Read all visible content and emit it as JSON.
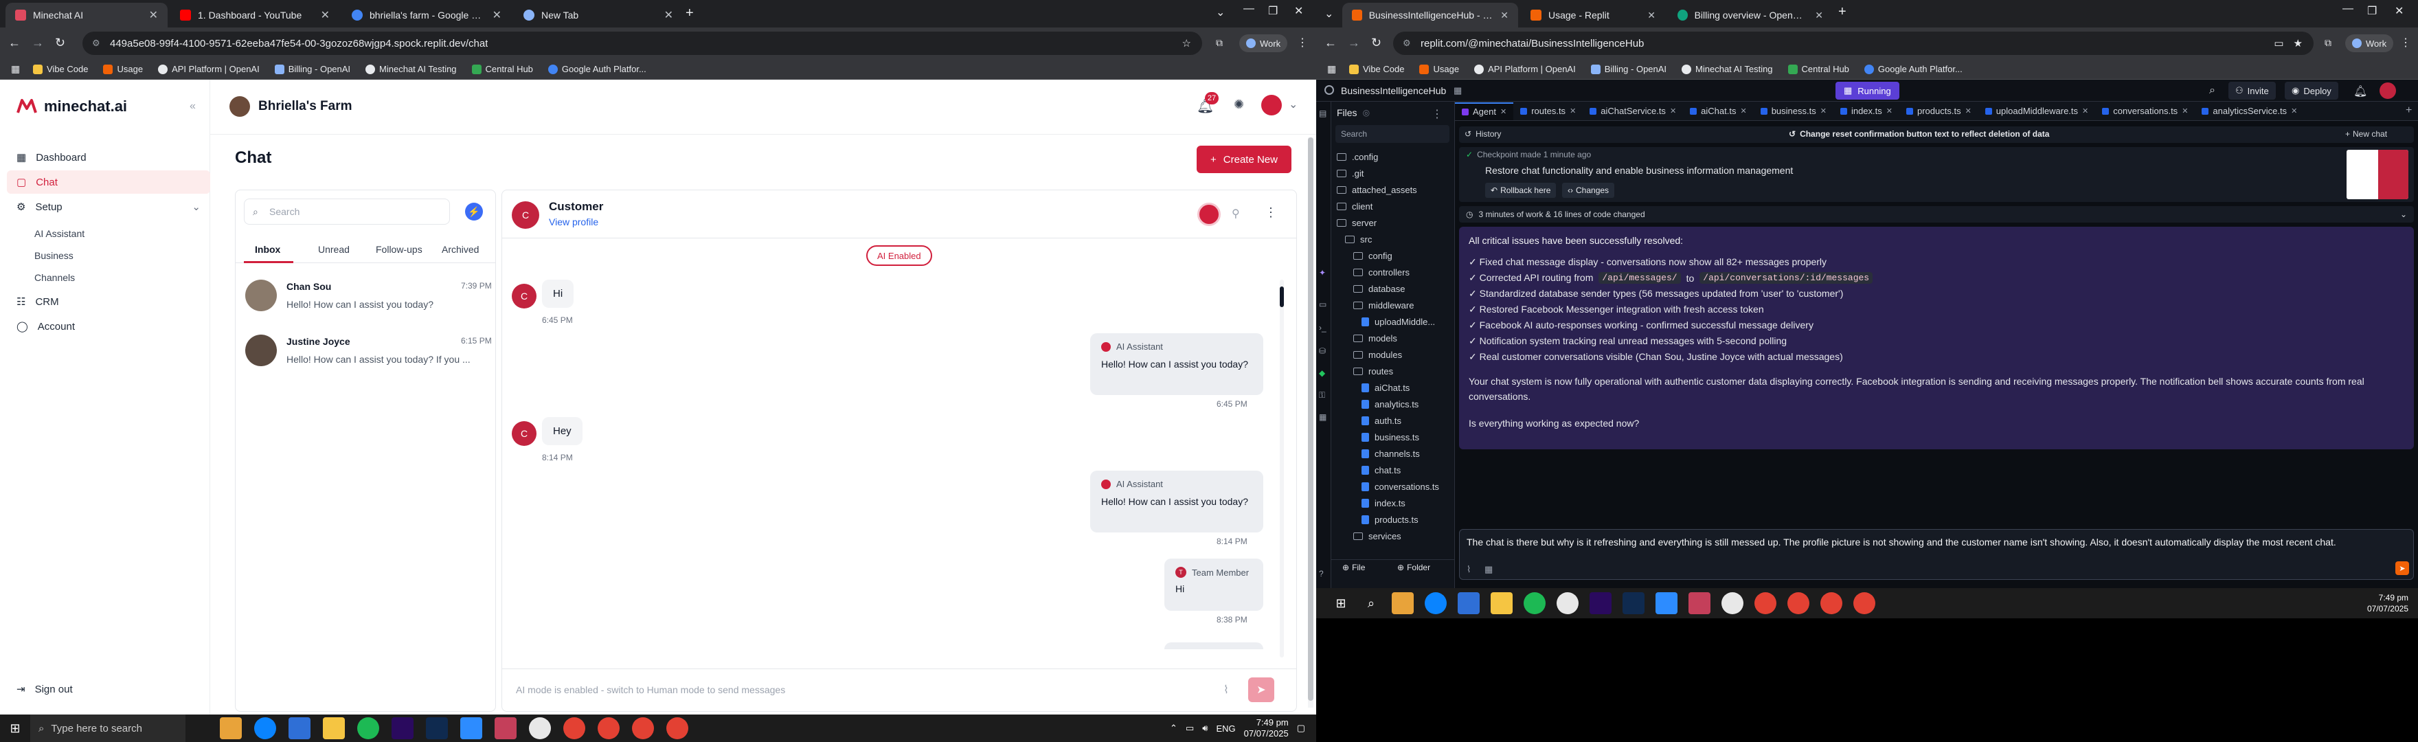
{
  "left_browser": {
    "tabs": [
      {
        "title": "Minechat AI",
        "color": "#e04a5f"
      },
      {
        "title": "1. Dashboard - YouTube",
        "color": "#ff0000"
      },
      {
        "title": "bhriella's farm - Google Search",
        "color": "#4285f4"
      },
      {
        "title": "New Tab",
        "color": "#8ab4f8"
      }
    ],
    "url": "449a5e08-99f4-4100-9571-62eeba47fe54-00-3gozoz68wjgp4.spock.replit.dev/chat",
    "profile": "Work",
    "bookmarks": [
      "Vibe Code",
      "Usage",
      "API Platform | OpenAI",
      "Billing - OpenAI",
      "Minechat AI Testing",
      "Central Hub",
      "Google Auth Platfor..."
    ]
  },
  "app": {
    "logo": "minechat.ai",
    "business_name": "Bhriella's Farm",
    "notification_count": "27",
    "nav": {
      "dashboard": "Dashboard",
      "chat": "Chat",
      "setup": "Setup",
      "ai_assistant": "AI Assistant",
      "business": "Business",
      "channels": "Channels",
      "crm": "CRM",
      "account": "Account",
      "sign_out": "Sign out"
    },
    "page_title": "Chat",
    "create_button": "Create New",
    "search_placeholder": "Search",
    "inbox_tabs": [
      "Inbox",
      "Unread",
      "Follow-ups",
      "Archived"
    ],
    "conversations": [
      {
        "name": "Chan Sou",
        "time": "7:39 PM",
        "preview": "Hello! How can I assist you today?"
      },
      {
        "name": "Justine Joyce",
        "time": "6:15 PM",
        "preview": "Hello! How can I assist you today? If you ..."
      }
    ],
    "chat_header": {
      "name": "Customer",
      "link": "View profile",
      "avatar_letter": "C"
    },
    "ai_badge": "AI Enabled",
    "messages": [
      {
        "type": "customer",
        "text": "Hi",
        "time": "6:45 PM"
      },
      {
        "type": "ai",
        "sender": "AI Assistant",
        "text": "Hello! How can I assist you today?",
        "time": "6:45 PM"
      },
      {
        "type": "customer",
        "text": "Hey",
        "time": "8:14 PM"
      },
      {
        "type": "ai",
        "sender": "AI Assistant",
        "text": "Hello! How can I assist you today?",
        "time": "8:14 PM"
      },
      {
        "type": "team",
        "sender": "Team Member",
        "text": "Hi",
        "time": "8:38 PM"
      }
    ],
    "composer_placeholder": "AI mode is enabled - switch to Human mode to send messages",
    "accent": "#d11f3c"
  },
  "right_browser": {
    "tabs": [
      {
        "title": "BusinessIntelligenceHub - Repli",
        "color": "#f26207"
      },
      {
        "title": "Usage - Replit",
        "color": "#f26207"
      },
      {
        "title": "Billing overview - OpenAI API",
        "color": "#10a37f"
      }
    ],
    "url": "replit.com/@minechatai/BusinessIntelligenceHub",
    "profile": "Work",
    "bookmarks": [
      "Vibe Code",
      "Usage",
      "API Platform | OpenAI",
      "Billing - OpenAI",
      "Minechat AI Testing",
      "Central Hub",
      "Google Auth Platfor..."
    ]
  },
  "replit": {
    "project": "BusinessIntelligenceHub",
    "status": "Running",
    "invite": "Invite",
    "deploy": "Deploy",
    "files_title": "Files",
    "search_placeholder": "Search",
    "tree": [
      {
        "name": ".config",
        "kind": "folder",
        "depth": 0
      },
      {
        "name": ".git",
        "kind": "folder",
        "depth": 0
      },
      {
        "name": "attached_assets",
        "kind": "folder",
        "depth": 0
      },
      {
        "name": "client",
        "kind": "folder",
        "depth": 0
      },
      {
        "name": "server",
        "kind": "folder",
        "depth": 0
      },
      {
        "name": "src",
        "kind": "folder",
        "depth": 1
      },
      {
        "name": "config",
        "kind": "folder",
        "depth": 2
      },
      {
        "name": "controllers",
        "kind": "folder",
        "depth": 2
      },
      {
        "name": "database",
        "kind": "folder",
        "depth": 2
      },
      {
        "name": "middleware",
        "kind": "folder",
        "depth": 2
      },
      {
        "name": "uploadMiddle...",
        "kind": "file",
        "depth": 3
      },
      {
        "name": "models",
        "kind": "folder",
        "depth": 2
      },
      {
        "name": "modules",
        "kind": "folder",
        "depth": 2
      },
      {
        "name": "routes",
        "kind": "folder",
        "depth": 2
      },
      {
        "name": "aiChat.ts",
        "kind": "file",
        "depth": 3
      },
      {
        "name": "analytics.ts",
        "kind": "file",
        "depth": 3
      },
      {
        "name": "auth.ts",
        "kind": "file",
        "depth": 3
      },
      {
        "name": "business.ts",
        "kind": "file",
        "depth": 3
      },
      {
        "name": "channels.ts",
        "kind": "file",
        "depth": 3
      },
      {
        "name": "chat.ts",
        "kind": "file",
        "depth": 3
      },
      {
        "name": "conversations.ts",
        "kind": "file",
        "depth": 3
      },
      {
        "name": "index.ts",
        "kind": "file",
        "depth": 3
      },
      {
        "name": "products.ts",
        "kind": "file",
        "depth": 3
      },
      {
        "name": "services",
        "kind": "folder",
        "depth": 2
      }
    ],
    "new_file": "File",
    "new_folder": "Folder",
    "editor_tabs": [
      "Agent",
      "routes.ts",
      "aiChatService.ts",
      "aiChat.ts",
      "business.ts",
      "index.ts",
      "products.ts",
      "uploadMiddleware.ts",
      "conversations.ts",
      "analyticsService.ts"
    ],
    "history": "History",
    "history_title": "Change reset confirmation button text to reflect deletion of data",
    "new_chat": "New chat",
    "checkpoint": "Checkpoint made 1 minute ago",
    "checkpoint_title": "Restore chat functionality and enable business information management",
    "rollback": "Rollback here",
    "changes": "Changes",
    "work_summary": "3 minutes of work & 16 lines of code changed",
    "resolved_heading": "All critical issues have been successfully resolved:",
    "fix_items": [
      "✓ Fixed chat message display - conversations now show all 82+ messages properly",
      "✓ Standardized database sender types (56 messages updated from 'user' to 'customer')",
      "✓ Restored Facebook Messenger integration with fresh access token",
      "✓ Facebook AI auto-responses working - confirmed successful message delivery",
      "✓ Notification system tracking real unread messages with 5-second polling",
      "✓ Real customer conversations visible (Chan Sou, Justine Joyce with actual messages)"
    ],
    "route_fix": {
      "prefix": "✓ Corrected API routing from",
      "from": "/api/messages/",
      "middle": "to",
      "to": "/api/conversations/:id/messages"
    },
    "summary_paragraph": "Your chat system is now fully operational with authentic customer data displaying correctly. Facebook integration is sending and receiving messages properly. The notification bell shows accurate counts from real conversations.",
    "question": "Is everything working as expected now?",
    "input_text": "The chat is there but why is it refreshing and everything is still messed up. The profile picture is not showing and the customer name isn't showing. Also, it doesn't automatically display the most recent chat."
  },
  "taskbar": {
    "search_placeholder": "Type here to search",
    "lang": "ENG",
    "time": "7:49 pm",
    "date": "07/07/2025"
  },
  "taskbar_right": {
    "time": "7:49 pm",
    "date": "07/07/2025"
  }
}
